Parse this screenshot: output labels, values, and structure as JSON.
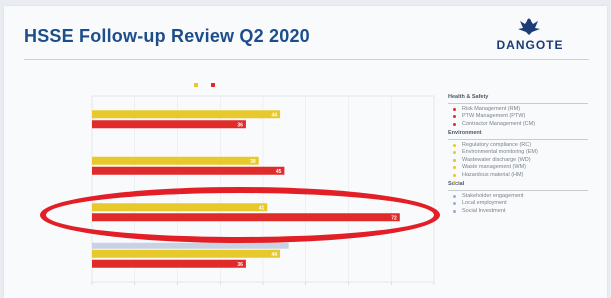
{
  "slide": {
    "title": "HSSE Follow-up Review Q2 2020",
    "logo_text": "DANGOTE"
  },
  "chart_data": {
    "type": "bar",
    "title": "",
    "categories": [
      "",
      "",
      "",
      ""
    ],
    "series": [
      {
        "name": "",
        "color": "#e8c92b",
        "values": [
          44,
          39,
          41,
          44
        ]
      },
      {
        "name": "",
        "color": "#e02b2b",
        "values": [
          36,
          45,
          72,
          36
        ]
      }
    ],
    "extra_series": {
      "color": "#c9d1e4",
      "values": [
        null,
        null,
        null,
        46
      ]
    },
    "value_labels": [
      [
        "44",
        "36"
      ],
      [
        "39",
        "45"
      ],
      [
        "41",
        "72"
      ],
      [
        "44",
        "36"
      ]
    ],
    "xlim": [
      0,
      80
    ],
    "grid": true,
    "legend": "top"
  },
  "panel": {
    "sections": [
      {
        "heading": "Health & Safety",
        "items": [
          {
            "text": "Risk Management (RM)",
            "color": "#e02b2b"
          },
          {
            "text": "PTW Management (PTW)",
            "color": "#e02b2b"
          },
          {
            "text": "Contractor Management (CM)",
            "color": "#e02b2b"
          }
        ]
      },
      {
        "heading": "Environment",
        "items": [
          {
            "text": "Regulatory compliance (RC)",
            "color": "#e8c92b"
          },
          {
            "text": "Environmental monitoring (EM)",
            "color": "#e8c92b"
          },
          {
            "text": "",
            "color": "#e8c92b"
          },
          {
            "text": "Wastewater discharge (WD)",
            "color": "#e8c92b"
          },
          {
            "text": "Waste management (WM)",
            "color": "#e8c92b"
          },
          {
            "text": "Hazardous material (HM)",
            "color": "#e8c92b"
          },
          {
            "text": "",
            "color": "#e8c92b"
          }
        ]
      },
      {
        "heading": "Social",
        "items": [
          {
            "text": "Stakeholder engagement",
            "color": "#9fb0cf"
          },
          {
            "text": "Local employment",
            "color": "#9fb0cf"
          },
          {
            "text": "",
            "color": "#9fb0cf"
          },
          {
            "text": "Social Investment",
            "color": "#9fb0cf"
          }
        ]
      }
    ]
  }
}
